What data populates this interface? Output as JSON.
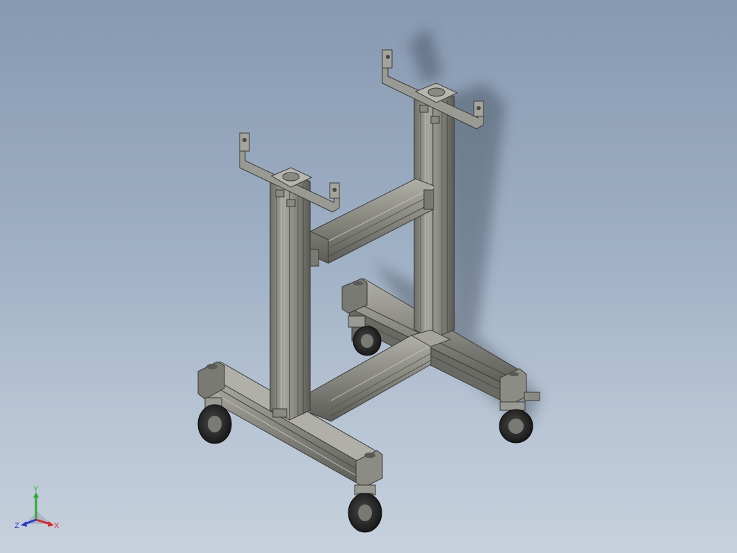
{
  "viewport": {
    "background_top": "#8799b1",
    "background_bottom": "#c7d1dd"
  },
  "model": {
    "profile_color": "#8a8a84",
    "profile_dark": "#4e4e4a",
    "profile_light": "#b4b4ac",
    "wheel_color": "#2a2a2a",
    "bracket_color": "#9a9a94"
  },
  "triad": {
    "x_label": "X",
    "y_label": "Y",
    "z_label": "Z",
    "x_color": "#d42a2a",
    "y_color": "#2fa82f",
    "z_color": "#2a3ad4"
  }
}
